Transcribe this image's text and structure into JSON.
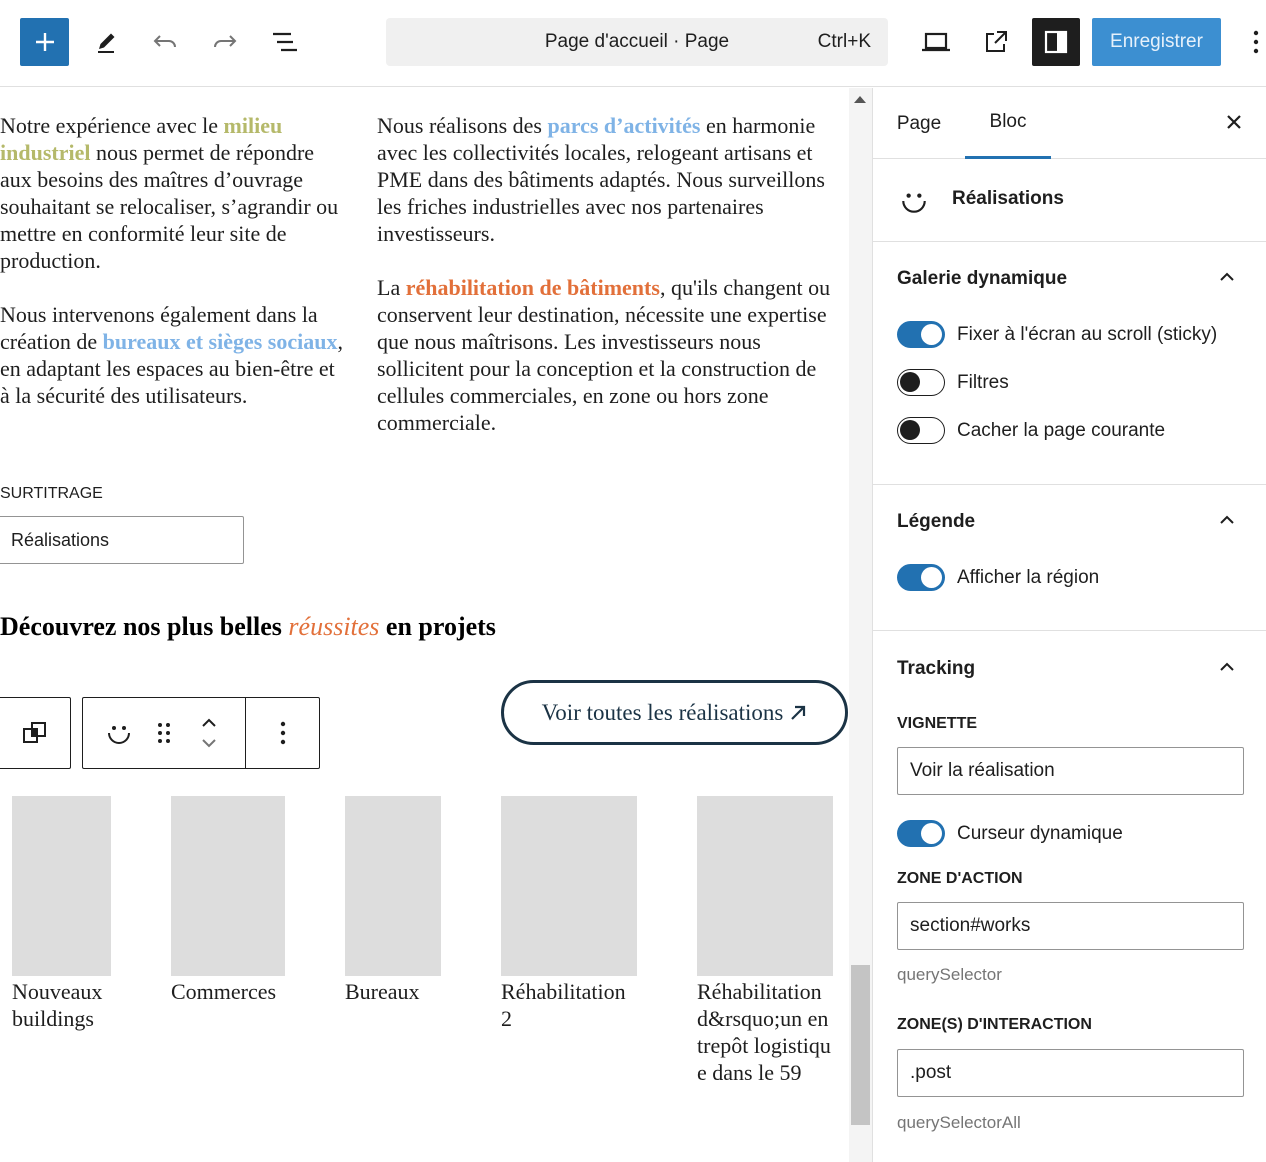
{
  "toolbar": {
    "doc_title": "Page d'accueil · Page",
    "doc_shortcut": "Ctrl+K",
    "save_label": "Enregistrer"
  },
  "content": {
    "col1_p1_a": "Notre expérience avec le ",
    "col1_p1_link": "milieu industriel",
    "col1_p1_b": " nous permet de répondre aux besoins des maîtres d’ouvrage souhaitant se relocaliser, s’agrandir ou mettre en conformité leur site de production.",
    "col1_p2_a": "Nous intervenons également dans la création de ",
    "col1_p2_link": "bureaux et sièges sociaux",
    "col1_p2_b": ", en adaptant les espaces au bien-être et à la sécurité des utilisateurs.",
    "col2_p1_a": "Nous réalisons des ",
    "col2_p1_link": "parcs d’activités",
    "col2_p1_b": " en harmonie avec les collectivités locales, relogeant artisans et PME dans des bâtiments adaptés. Nous surveillons les friches industrielles avec nos partenaires investisseurs.",
    "col2_p2_a": "La ",
    "col2_p2_link": "réhabilitation de bâtiments",
    "col2_p2_b": ", qu'ils changent ou conservent leur destination, nécessite une expertise que nous maîtrisons. Les investisseurs nous sollicitent pour la conception et la construction de cellules commerciales, en zone ou hors zone commerciale.",
    "surtitrage_label": "SURTITRAGE",
    "surtitrage_value": "Réalisations",
    "heading_a": "Découvrez nos plus belles ",
    "heading_em": "réussites",
    "heading_b": " en projets",
    "voir_label": "Voir toutes les réalisations",
    "categories": [
      {
        "label": "Nouveaux buildings"
      },
      {
        "label": "Commerces"
      },
      {
        "label": "Bureaux"
      },
      {
        "label": "Réhabilitation 2"
      },
      {
        "label": "Réhabilitation d&rsquo;un entrepôt logistique dans le 59"
      }
    ]
  },
  "sidebar": {
    "tab_page": "Page",
    "tab_bloc": "Bloc",
    "block_name": "Réalisations",
    "galerie": {
      "title": "Galerie dynamique",
      "sticky_label": "Fixer à l'écran au scroll (sticky)",
      "sticky_on": true,
      "filtres_label": "Filtres",
      "filtres_on": false,
      "cacher_label": "Cacher la page courante",
      "cacher_on": false
    },
    "legende": {
      "title": "Légende",
      "region_label": "Afficher la région",
      "region_on": true
    },
    "tracking": {
      "title": "Tracking",
      "vignette_label": "VIGNETTE",
      "vignette_value": "Voir la réalisation",
      "curseur_label": "Curseur dynamique",
      "curseur_on": true,
      "zone_action_label": "ZONE D'ACTION",
      "zone_action_value": "section#works",
      "zone_action_help": "querySelector",
      "zone_interaction_label": "ZONE(S) D'INTERACTION",
      "zone_interaction_value": ".post",
      "zone_interaction_help": "querySelectorAll"
    }
  },
  "colors": {
    "accent": "#2271b1",
    "link_green": "#b5b96a",
    "link_blue": "#7fb3e6",
    "link_orange": "#e2703a",
    "button_border": "#1b3345"
  }
}
